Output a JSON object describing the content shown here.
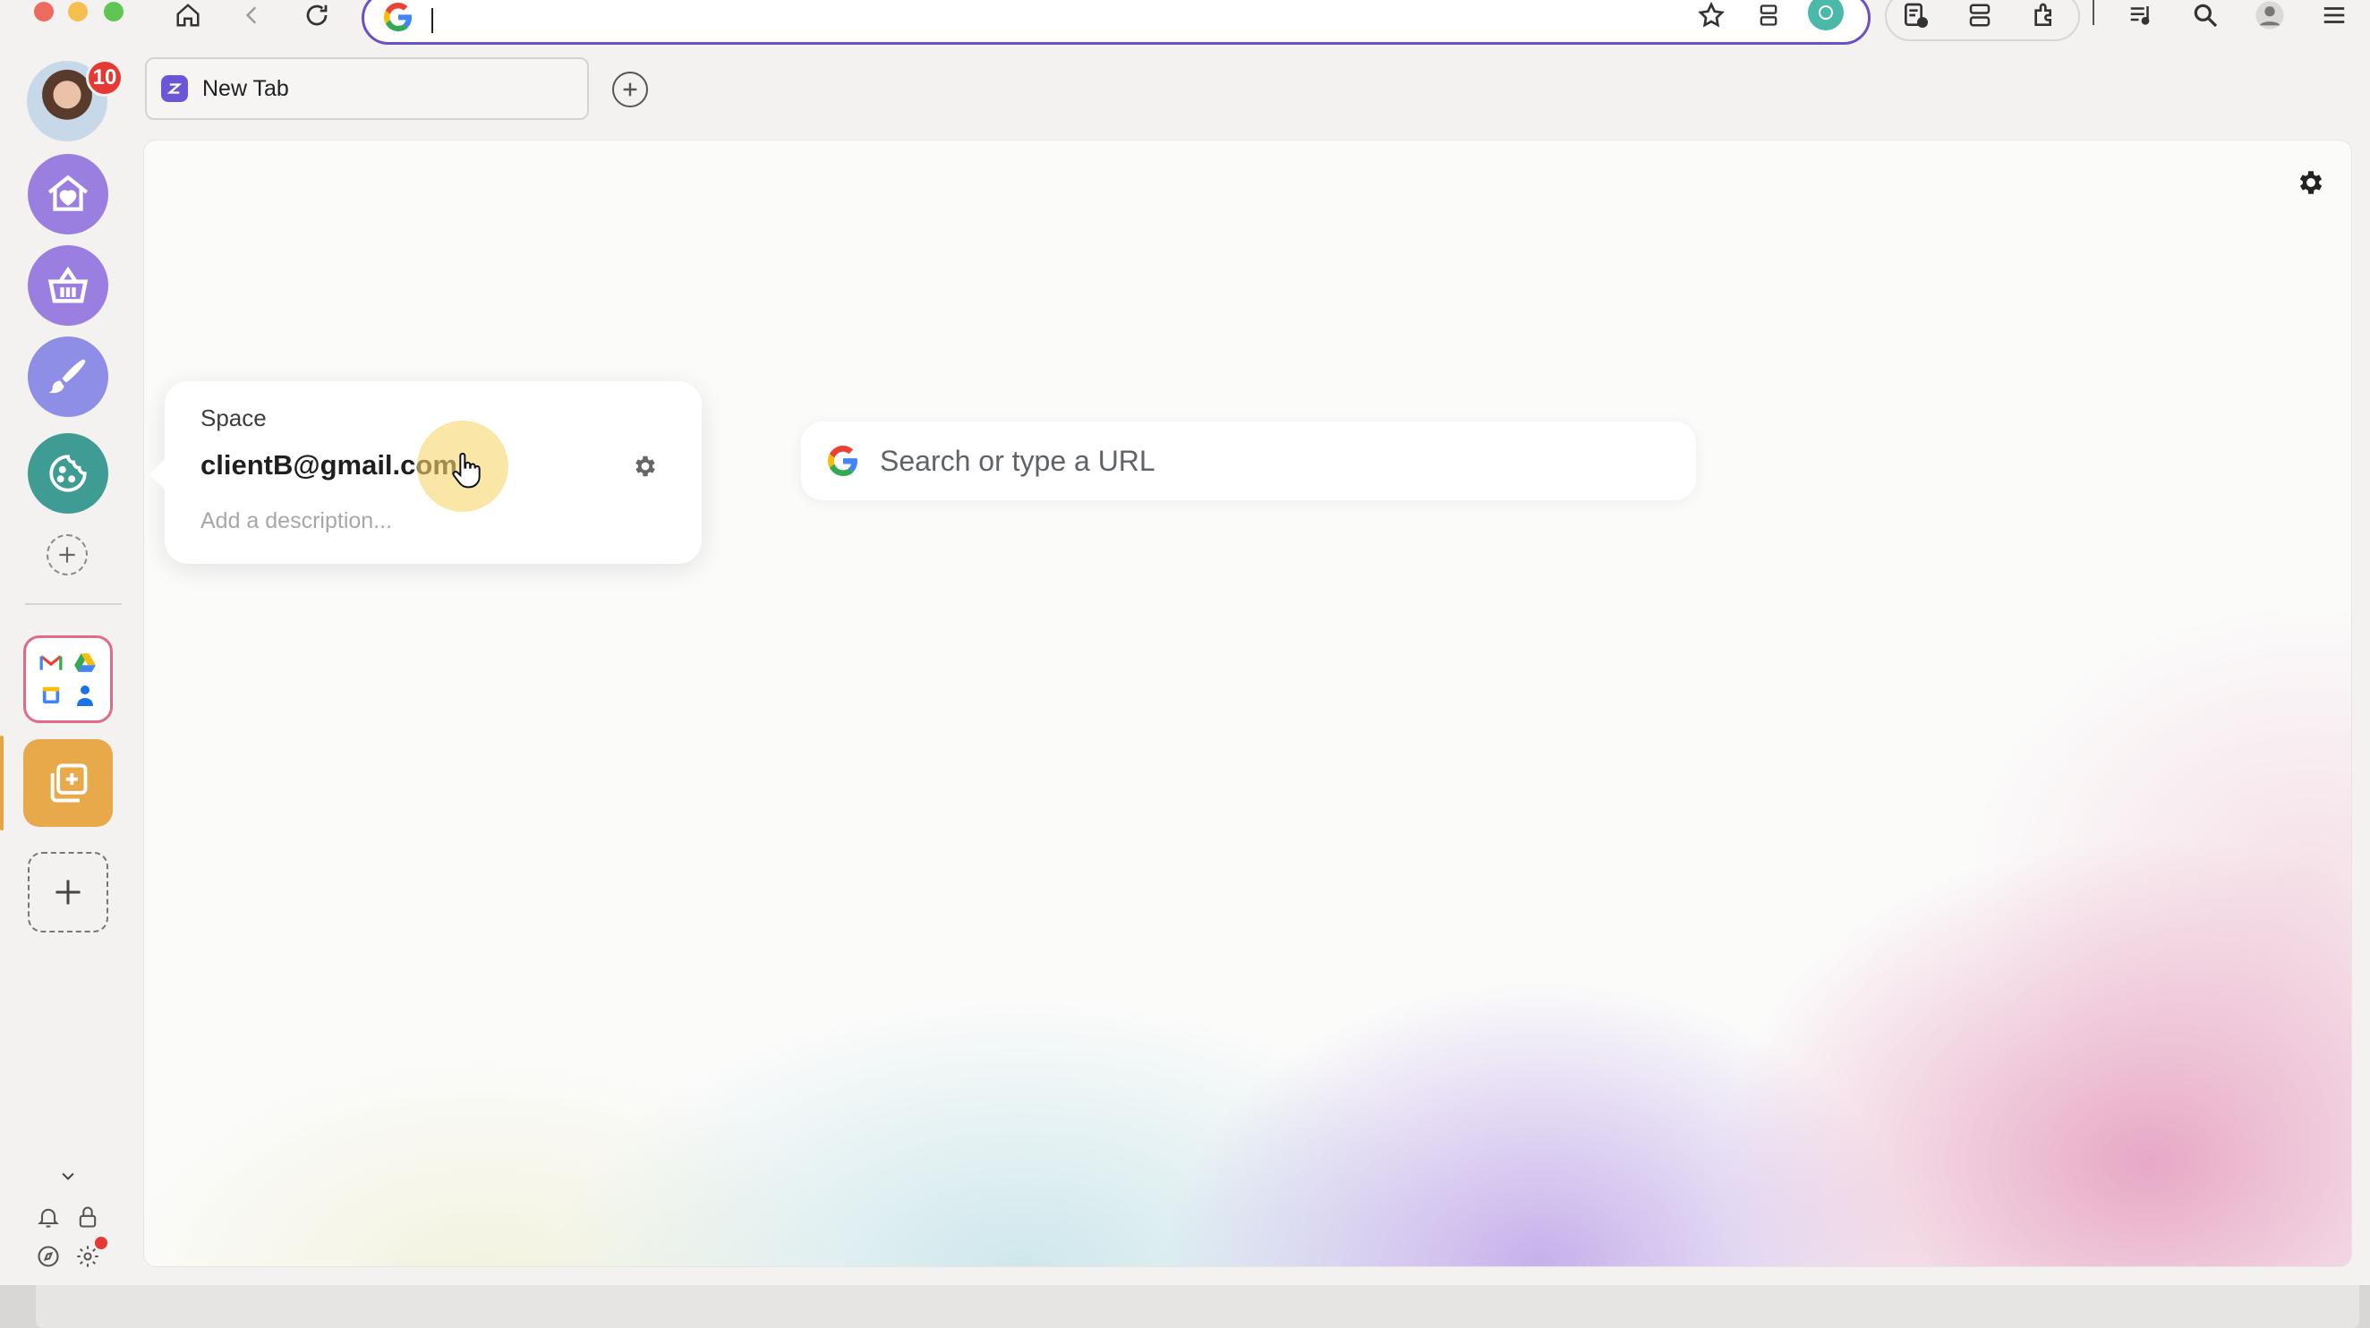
{
  "browser": {
    "url_value": ""
  },
  "tabs": [
    {
      "title": "New Tab"
    }
  ],
  "sidebar": {
    "notification_count": "10"
  },
  "search": {
    "placeholder": "Search or type a URL"
  },
  "space_popover": {
    "label": "Space",
    "name": "clientB@gmail.com",
    "description_placeholder": "Add a description..."
  },
  "colors": {
    "accent": "#6a4fc7",
    "badge": "#e53935",
    "active_space": "#e8a94b"
  }
}
